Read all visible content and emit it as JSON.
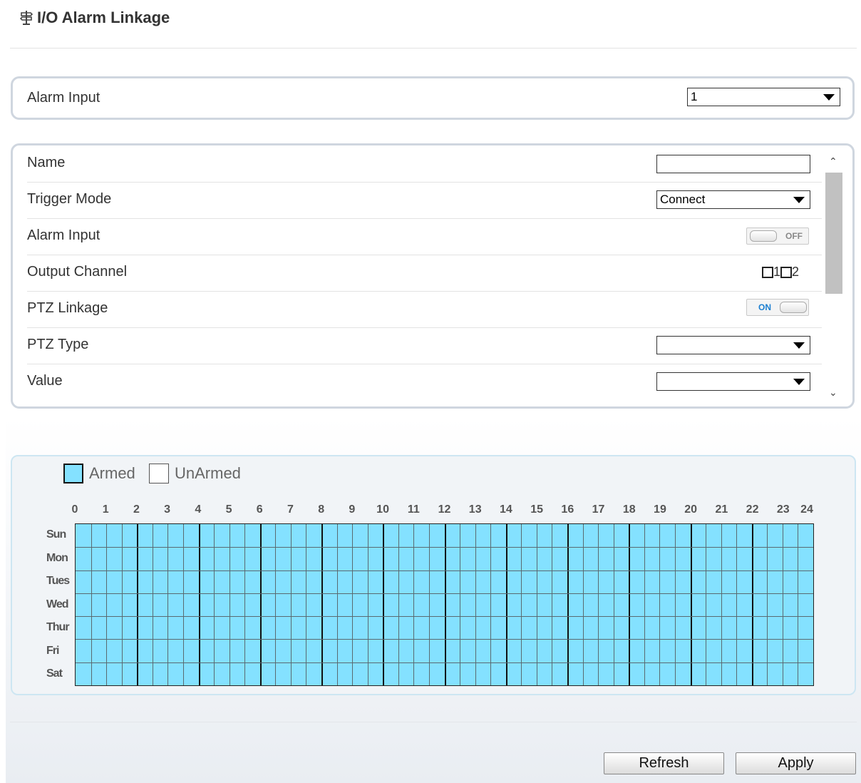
{
  "header": {
    "title": "I/O Alarm Linkage",
    "icon": "signpost-icon"
  },
  "alarm_input_panel": {
    "label": "Alarm Input",
    "value": "1"
  },
  "settings": {
    "name_label": "Name",
    "name_value": "",
    "trigger_mode_label": "Trigger Mode",
    "trigger_mode_value": "Connect",
    "alarm_input_label": "Alarm Input",
    "alarm_input_toggle": "OFF",
    "output_channel_label": "Output Channel",
    "output_channels": [
      "1",
      "2"
    ],
    "ptz_linkage_label": "PTZ Linkage",
    "ptz_linkage_toggle": "ON",
    "ptz_type_label": "PTZ Type",
    "ptz_type_value": "",
    "value_label": "Value",
    "value_value": ""
  },
  "schedule": {
    "legend_armed": "Armed",
    "legend_unarmed": "UnArmed",
    "hours": [
      "0",
      "1",
      "2",
      "3",
      "4",
      "5",
      "6",
      "7",
      "8",
      "9",
      "10",
      "11",
      "12",
      "13",
      "14",
      "15",
      "16",
      "17",
      "18",
      "19",
      "20",
      "21",
      "22",
      "23",
      "24"
    ],
    "days": [
      "Sun",
      "Mon",
      "Tues",
      "Wed",
      "Thur",
      "Fri",
      "Sat"
    ],
    "armed_color": "#84e1ff"
  },
  "buttons": {
    "refresh": "Refresh",
    "apply": "Apply"
  }
}
